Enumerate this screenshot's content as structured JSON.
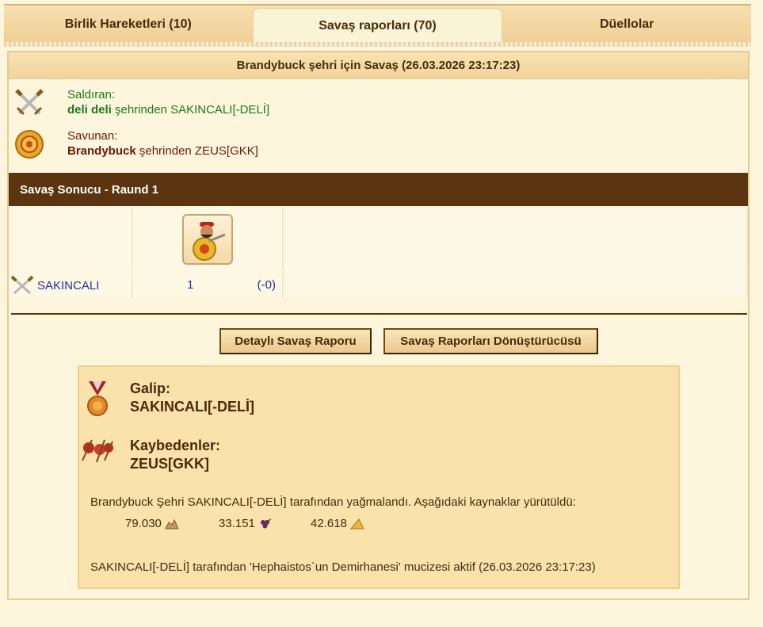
{
  "tabs": [
    {
      "label": "Birlik Hareketleri (10)"
    },
    {
      "label": "Savaş raporları (70)"
    },
    {
      "label": "Düellolar"
    }
  ],
  "report": {
    "title": "Brandybuck şehri için Savaş (26.03.2026 23:17:23)",
    "attacker": {
      "role": "Saldıran:",
      "player": "deli deli",
      "suffix": " şehrinden SAKINCALI[-DELİ]",
      "icon": "crossed-swords-icon"
    },
    "defender": {
      "role": "Savunan:",
      "player": "Brandybuck",
      "suffix": " şehrinden ZEUS[GKK]",
      "icon": "shield-icon"
    }
  },
  "battle_result": {
    "header": "Savaş Sonucu - Raund 1",
    "row": {
      "name": "SAKINCALI",
      "count": "1",
      "loss": "(-0)"
    },
    "unit_icon": "warrior-portrait-icon"
  },
  "buttons": {
    "detailed_report": "Detaylı Savaş Raporu",
    "converter": "Savaş Raporları Dönüştürücüsü"
  },
  "summary": {
    "winner_label": "Galip:",
    "winner": "SAKINCALI[-DELİ]",
    "losers_label": "Kaybedenler:",
    "losers": "ZEUS[GKK]",
    "plunder_text": "Brandybuck Şehri SAKINCALI[-DELİ] tarafından yağmalandı. Aşağıdaki kaynaklar yürütüldü:",
    "resources": [
      {
        "amount": "79.030",
        "icon": "stone-icon"
      },
      {
        "amount": "33.151",
        "icon": "grape-icon"
      },
      {
        "amount": "42.618",
        "icon": "cheese-icon"
      }
    ],
    "wonder_text": "SAKINCALI[-DELİ] tarafından 'Hephaistos`un Demirhanesi' mucizesi aktif (26.03.2026 23:17:23)"
  },
  "colors": {
    "tab_bg": "#efcf95",
    "header_brown": "#5a3510",
    "attacker_green": "#1a7a1a",
    "defender_red": "#6b1a0a",
    "link_blue": "#2a2aa8"
  }
}
